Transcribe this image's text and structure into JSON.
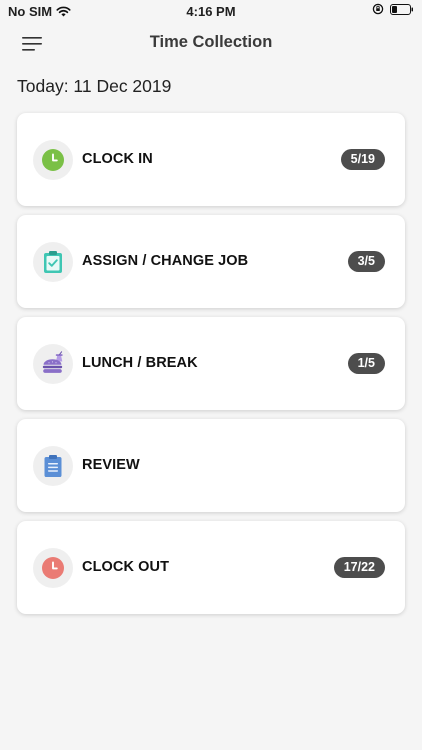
{
  "status": {
    "carrier": "No SIM",
    "time": "4:16 PM"
  },
  "nav": {
    "title": "Time Collection"
  },
  "today": "Today: 11 Dec 2019",
  "items": [
    {
      "label": "CLOCK IN",
      "badge": "5/19",
      "icon": "clock-icon",
      "color": "#7ac046"
    },
    {
      "label": "ASSIGN / CHANGE JOB",
      "badge": "3/5",
      "icon": "clipboard-check-icon",
      "color": "#3fc6b3"
    },
    {
      "label": "LUNCH / BREAK",
      "badge": "1/5",
      "icon": "burger-drink-icon",
      "color": "#8a6fc8"
    },
    {
      "label": "REVIEW",
      "badge": "",
      "icon": "document-list-icon",
      "color": "#5b8fd6"
    },
    {
      "label": "CLOCK OUT",
      "badge": "17/22",
      "icon": "clock-icon",
      "color": "#ea7b74"
    }
  ]
}
